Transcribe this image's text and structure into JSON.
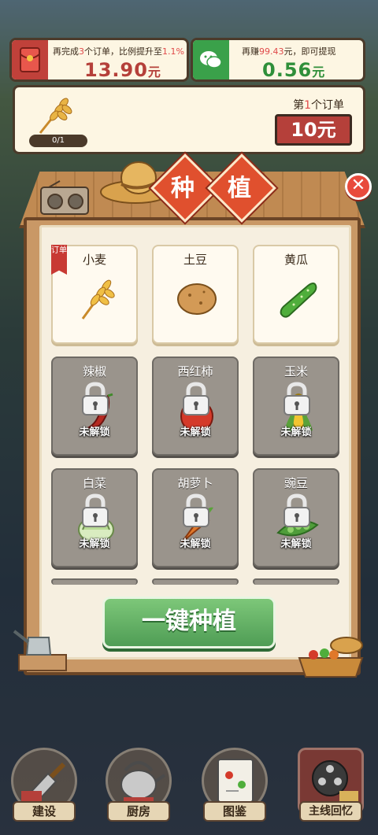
{
  "top_left": {
    "caption_pre": "再完成",
    "caption_num": "3",
    "caption_mid": "个订单，比例提升至",
    "caption_rate": "1.1%",
    "amount": "13.90",
    "unit": "元",
    "accent": "#b5403a"
  },
  "top_right": {
    "caption_pre": "再赚",
    "caption_num": "99.43",
    "caption_post": "元，即可提现",
    "amount": "0.56",
    "unit": "元",
    "accent": "#2f8f3a"
  },
  "order": {
    "progress": "0/1",
    "title_pre": "第",
    "title_num": "1",
    "title_post": "个订单",
    "reward": "10元"
  },
  "modal": {
    "title_char_1": "种",
    "title_char_2": "植",
    "close_glyph": "✕",
    "order_tag": "订单",
    "crops": [
      {
        "name": "小麦",
        "locked": false,
        "icon": "wheat-icon"
      },
      {
        "name": "土豆",
        "locked": false,
        "icon": "potato-icon"
      },
      {
        "name": "黄瓜",
        "locked": false,
        "icon": "cucumber-icon"
      },
      {
        "name": "辣椒",
        "locked": true,
        "icon": "chili-icon"
      },
      {
        "name": "西红柿",
        "locked": true,
        "icon": "tomato-icon"
      },
      {
        "name": "玉米",
        "locked": true,
        "icon": "corn-icon"
      },
      {
        "name": "白菜",
        "locked": true,
        "icon": "cabbage-icon"
      },
      {
        "name": "胡萝卜",
        "locked": true,
        "icon": "carrot-icon"
      },
      {
        "name": "豌豆",
        "locked": true,
        "icon": "pea-icon"
      }
    ],
    "locked_label": "未解锁",
    "plant_button": "一键种植"
  },
  "nav": [
    {
      "label": "建设",
      "icon": "trowel-icon"
    },
    {
      "label": "厨房",
      "icon": "kettle-icon"
    },
    {
      "label": "图鉴",
      "icon": "book-icon"
    },
    {
      "label": "主线回忆",
      "icon": "film-reel-icon"
    }
  ]
}
